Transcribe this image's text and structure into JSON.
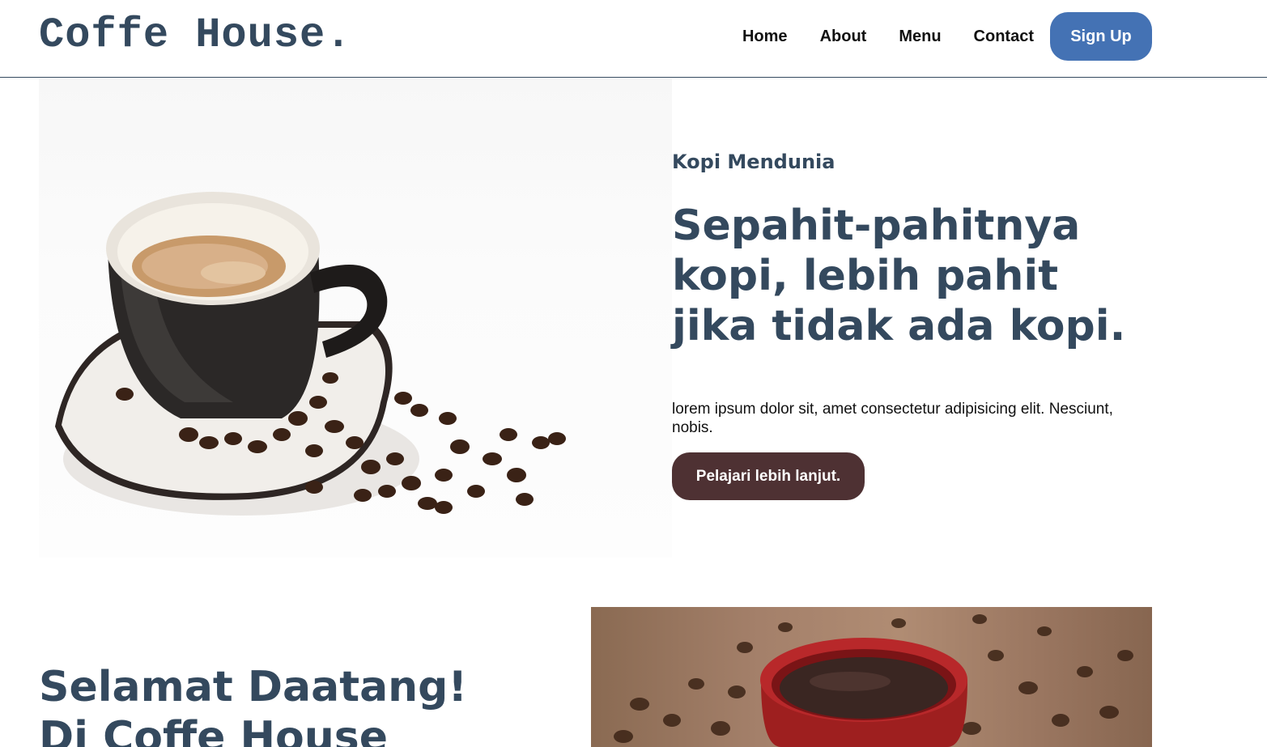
{
  "header": {
    "logo": "Coffe House.",
    "nav": [
      {
        "label": "Home"
      },
      {
        "label": "About"
      },
      {
        "label": "Menu"
      },
      {
        "label": "Contact"
      }
    ],
    "signup_label": "Sign Up"
  },
  "hero": {
    "eyebrow": "Kopi Mendunia",
    "headline": "Sepahit-pahitnya kopi, lebih pahit jika tidak ada kopi.",
    "lead": "lorem ipsum dolor sit, amet consectetur adipisicing elit. Nesciunt, nobis.",
    "cta_label": "Pelajari lebih lanjut.",
    "image_icon": "coffee-cup-with-beans-image"
  },
  "welcome": {
    "line1": "Selamat Daatang!",
    "line2": "Di Coffe House",
    "image_icon": "red-coffee-cup-image"
  },
  "colors": {
    "brand": "#34495e",
    "signup": "#4472b4",
    "cta": "#4e3133"
  }
}
